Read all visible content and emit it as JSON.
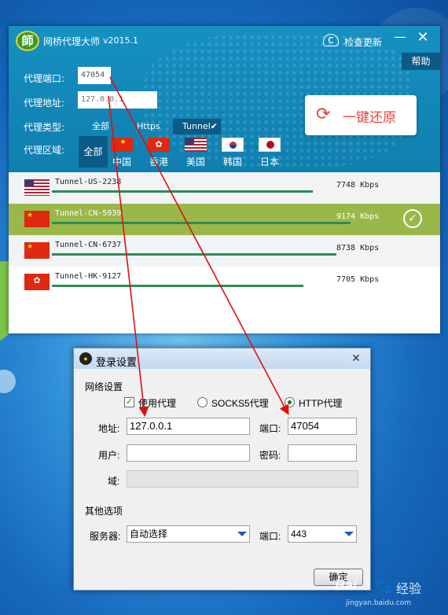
{
  "app": {
    "title": "网桥代理大师",
    "version": "v2015.1",
    "check_update": "检查更新",
    "help": "帮助",
    "labels": {
      "port": "代理端口:",
      "address": "代理地址:",
      "type": "代理类型:",
      "region": "代理区域:"
    },
    "port_value": "47054",
    "address_value": "127.0.0.1",
    "types": [
      "全部",
      "Https",
      "Tunnel"
    ],
    "selected_type": "Tunnel",
    "regions": [
      "全部",
      "中国",
      "香港",
      "美国",
      "韩国",
      "日本"
    ],
    "selected_region": "全部",
    "restore_button": "一键还原",
    "tunnels": [
      {
        "flag": "us-flag",
        "name": "Tunnel-US-2238",
        "speed": "7748 Kbps",
        "selected": false
      },
      {
        "flag": "cn-flag",
        "name": "Tunnel-CN-5939",
        "speed": "9174 Kbps",
        "selected": true
      },
      {
        "flag": "cn-flag",
        "name": "Tunnel-CN-6737",
        "speed": "8738 Kbps",
        "selected": false
      },
      {
        "flag": "hk-flag",
        "name": "Tunnel-HK-9127",
        "speed": "7705 Kbps",
        "selected": false
      }
    ],
    "colors": {
      "header": "#1690c2",
      "selected_row": "#9ab84a",
      "restore": "#e4443b"
    }
  },
  "dialog": {
    "title": "登录设置",
    "network_section": "网络设置",
    "use_proxy": "使用代理",
    "socks5": "SOCKS5代理",
    "http": "HTTP代理",
    "address_label": "地址:",
    "address_value": "127.0.0.1",
    "port_label": "端口:",
    "port_value": "47054",
    "user_label": "用户:",
    "user_value": "",
    "password_label": "密码:",
    "password_value": "",
    "domain_label": "域:",
    "domain_value": "",
    "other_section": "其他选项",
    "server_label": "服务器:",
    "server_value": "自动选择",
    "server_port_label": "端口:",
    "server_port_value": "443",
    "ok_button": "确定"
  },
  "watermark": {
    "brand": "Bai",
    "brand2": "经验",
    "url": "jingyan.baidu.com"
  }
}
